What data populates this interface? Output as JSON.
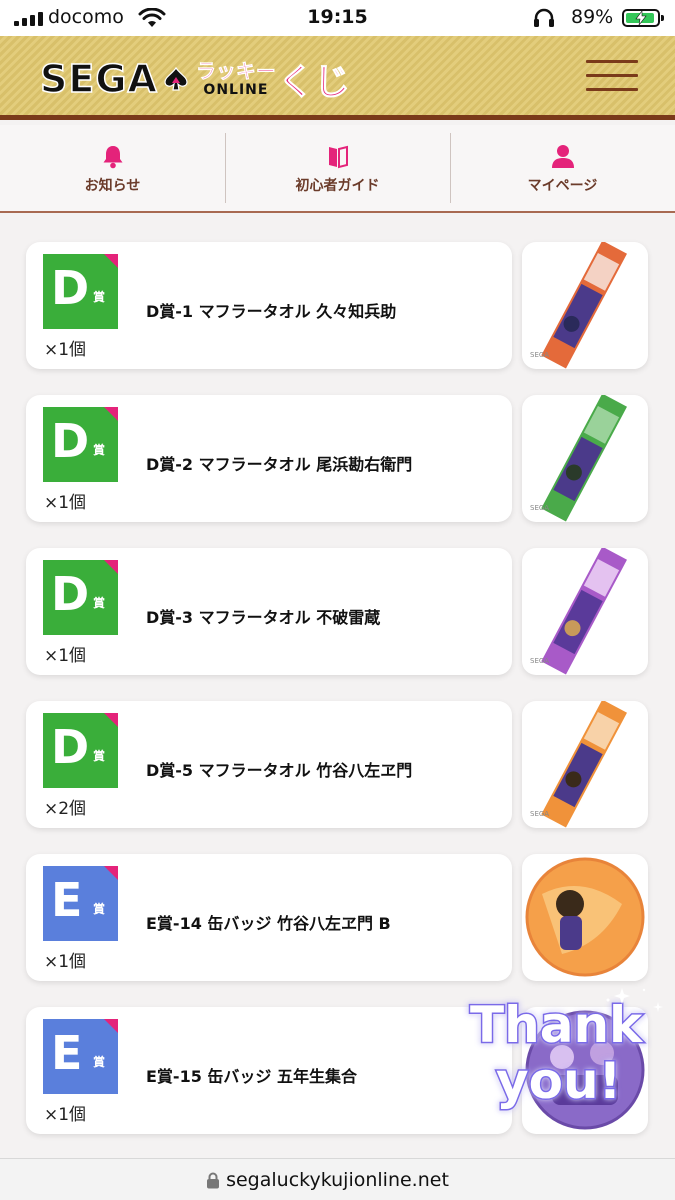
{
  "status_bar": {
    "carrier": "docomo",
    "time": "19:15",
    "battery": "89%",
    "icons": [
      "signal-icon",
      "wifi-icon",
      "headphones-icon",
      "battery-charging-icon"
    ]
  },
  "header": {
    "logo": {
      "sega": "SEGA",
      "lucky": "ラッキー",
      "online": "ONLINE",
      "kuji": "くじ"
    },
    "menu_icon": "hamburger-menu-icon",
    "accent_color": "#7a3a1a",
    "brand_pink": "#e4237a"
  },
  "nav": {
    "items": [
      {
        "label": "お知らせ",
        "icon": "bell-icon"
      },
      {
        "label": "初心者ガイド",
        "icon": "book-icon"
      },
      {
        "label": "マイページ",
        "icon": "person-icon"
      }
    ],
    "icon_color": "#e4237a"
  },
  "prizes": [
    {
      "grade": "D",
      "sho": "賞",
      "color": "#3aae3a",
      "title": "D賞-1 マフラータオル 久々知兵助",
      "qty": "×1個",
      "thumb": "towel-purple-red"
    },
    {
      "grade": "D",
      "sho": "賞",
      "color": "#3aae3a",
      "title": "D賞-2 マフラータオル 尾浜勘右衛門",
      "qty": "×1個",
      "thumb": "towel-purple-green"
    },
    {
      "grade": "D",
      "sho": "賞",
      "color": "#3aae3a",
      "title": "D賞-3 マフラータオル 不破雷蔵",
      "qty": "×1個",
      "thumb": "towel-purple-violet"
    },
    {
      "grade": "D",
      "sho": "賞",
      "color": "#3aae3a",
      "title": "D賞-5 マフラータオル 竹谷八左ヱ門",
      "qty": "×2個",
      "thumb": "towel-purple-orange"
    },
    {
      "grade": "E",
      "sho": "賞",
      "color": "#5a7fdc",
      "title": "E賞-14 缶バッジ 竹谷八左ヱ門 B",
      "qty": "×1個",
      "thumb": "badge-orange"
    },
    {
      "grade": "E",
      "sho": "賞",
      "color": "#5a7fdc",
      "title": "E賞-15 缶バッジ 五年生集合",
      "qty": "×1個",
      "thumb": "badge-purple"
    }
  ],
  "sticker": {
    "line1": "Thank",
    "line2": "you!"
  },
  "url_bar": {
    "url": "segaluckykujionline.net",
    "icon": "lock-icon"
  }
}
